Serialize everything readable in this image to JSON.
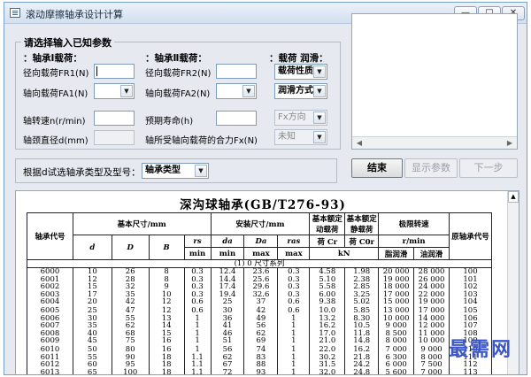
{
  "window": {
    "title": "滚动摩擦轴承设计计算",
    "minimize": "—",
    "maximize": "□",
    "close": "✕"
  },
  "input_group": {
    "title": "请选择输入已知参数",
    "axis1_title": "：轴承Ⅰ载荷：",
    "radial_load1_label": "径向载荷FR1(N)",
    "radial_load1_value": "",
    "axial_load1_label": "轴向载荷FA1(N)",
    "axial_load1_value": "",
    "axis2_title": "：轴承Ⅱ载荷：",
    "radial_load2_label": "径向载荷FR2(N)",
    "radial_load2_value": "",
    "axial_load2_label": "轴向载荷FA2(N)",
    "axial_load2_value": "",
    "load_lube_title": "：载荷 润滑：",
    "load_property_select": "载荷性质",
    "lube_method_select": "润滑方式",
    "speed_label": "轴转速n(r/min)",
    "speed_value": "",
    "life_label": "预期寿命(h)",
    "life_value": "",
    "fx_direction_select": "Fx方向",
    "journal_diameter_label": "轴颈直径d(mm)",
    "journal_diameter_value": "",
    "axial_resultant_label": "轴所受轴向载荷的合力Fx(N)",
    "axial_resultant_select": "未知"
  },
  "bearing_select": {
    "label": "根据d试选轴承类型及型号：",
    "type_select": "轴承类型"
  },
  "buttons": {
    "finish": "结束",
    "show_params": "显示参数",
    "next": "下一步"
  },
  "document": {
    "title": "深沟球轴承(GB/T276-93)",
    "headers": {
      "code": "轴承代号",
      "basic_dims": "基本尺寸/mm",
      "install_dims": "安装尺寸/mm",
      "dynamic_load": "基本额定动载荷",
      "static_load": "基本额定静载荷",
      "limit_speed": "极限转速",
      "orig_code": "原轴承代号",
      "d": "d",
      "D": "D",
      "B": "B",
      "rs": "rs",
      "rs_sub": "min",
      "da": "da",
      "da_sub": "min",
      "Da": "Da",
      "Da_sub": "max",
      "ras": "ras",
      "ras_sub": "max",
      "Cr": "荷 Cr",
      "Cor": "荷 C0r",
      "unit_kN": "kN",
      "unit_rpm": "r/min",
      "grease": "脂润滑",
      "oil": "油润滑"
    },
    "section_label": "(1) 0 尺寸系列",
    "rows": [
      {
        "code": "6000",
        "d": "10",
        "D": "26",
        "B": "8",
        "rs": "0.3",
        "da": "12.4",
        "Da": "23.6",
        "ras": "0.3",
        "Cr": "4.58",
        "Cor": "1.98",
        "grease": "20 000",
        "oil": "28 000",
        "orig": "100"
      },
      {
        "code": "6001",
        "d": "12",
        "D": "28",
        "B": "8",
        "rs": "0.3",
        "da": "14.4",
        "Da": "25.6",
        "ras": "0.3",
        "Cr": "5.10",
        "Cor": "2.38",
        "grease": "19 000",
        "oil": "26 000",
        "orig": "101"
      },
      {
        "code": "6002",
        "d": "15",
        "D": "32",
        "B": "9",
        "rs": "0.3",
        "da": "17.4",
        "Da": "29.6",
        "ras": "0.3",
        "Cr": "5.58",
        "Cor": "2.85",
        "grease": "18 000",
        "oil": "24 000",
        "orig": "102"
      },
      {
        "code": "6003",
        "d": "17",
        "D": "35",
        "B": "10",
        "rs": "0.3",
        "da": "19.4",
        "Da": "32.6",
        "ras": "0.3",
        "Cr": "6.00",
        "Cor": "3.25",
        "grease": "17 000",
        "oil": "22 000",
        "orig": "103"
      },
      {
        "code": "6004",
        "d": "20",
        "D": "42",
        "B": "12",
        "rs": "0.6",
        "da": "25",
        "Da": "37",
        "ras": "0.6",
        "Cr": "9.38",
        "Cor": "5.02",
        "grease": "15 000",
        "oil": "19 000",
        "orig": "104"
      },
      {
        "code": "6005",
        "d": "25",
        "D": "47",
        "B": "12",
        "rs": "0.6",
        "da": "30",
        "Da": "42",
        "ras": "0.6",
        "Cr": "10.0",
        "Cor": "5.85",
        "grease": "13 000",
        "oil": "17 000",
        "orig": "105"
      },
      {
        "code": "6006",
        "d": "30",
        "D": "55",
        "B": "13",
        "rs": "1",
        "da": "36",
        "Da": "49",
        "ras": "1",
        "Cr": "13.2",
        "Cor": "8.30",
        "grease": "10 000",
        "oil": "14 000",
        "orig": "106"
      },
      {
        "code": "6007",
        "d": "35",
        "D": "62",
        "B": "14",
        "rs": "1",
        "da": "41",
        "Da": "56",
        "ras": "1",
        "Cr": "16.2",
        "Cor": "10.5",
        "grease": "9 000",
        "oil": "12 000",
        "orig": "107"
      },
      {
        "code": "6008",
        "d": "40",
        "D": "68",
        "B": "15",
        "rs": "1",
        "da": "46",
        "Da": "62",
        "ras": "1",
        "Cr": "17.0",
        "Cor": "11.8",
        "grease": "8 500",
        "oil": "11 000",
        "orig": "108"
      },
      {
        "code": "6009",
        "d": "45",
        "D": "75",
        "B": "16",
        "rs": "1",
        "da": "51",
        "Da": "69",
        "ras": "1",
        "Cr": "21.0",
        "Cor": "14.8",
        "grease": "8 000",
        "oil": "10 000",
        "orig": "109"
      },
      {
        "code": "6010",
        "d": "50",
        "D": "80",
        "B": "16",
        "rs": "1",
        "da": "56",
        "Da": "74",
        "ras": "1",
        "Cr": "22.0",
        "Cor": "16.2",
        "grease": "7 000",
        "oil": "9 000",
        "orig": "110"
      },
      {
        "code": "6011",
        "d": "55",
        "D": "90",
        "B": "18",
        "rs": "1.1",
        "da": "62",
        "Da": "83",
        "ras": "1",
        "Cr": "30.2",
        "Cor": "21.8",
        "grease": "6 300",
        "oil": "8 000",
        "orig": "111"
      },
      {
        "code": "6012",
        "d": "60",
        "D": "95",
        "B": "18",
        "rs": "1.1",
        "da": "67",
        "Da": "88",
        "ras": "1",
        "Cr": "31.5",
        "Cor": "24.2",
        "grease": "6 000",
        "oil": "7 500",
        "orig": "112"
      },
      {
        "code": "6013",
        "d": "65",
        "D": "100",
        "B": "18",
        "rs": "1.1",
        "da": "72",
        "Da": "93",
        "ras": "1",
        "Cr": "32.0",
        "Cor": "24.8",
        "grease": "5 600",
        "oil": "7 000",
        "orig": "113"
      }
    ]
  },
  "watermark": "最需网"
}
